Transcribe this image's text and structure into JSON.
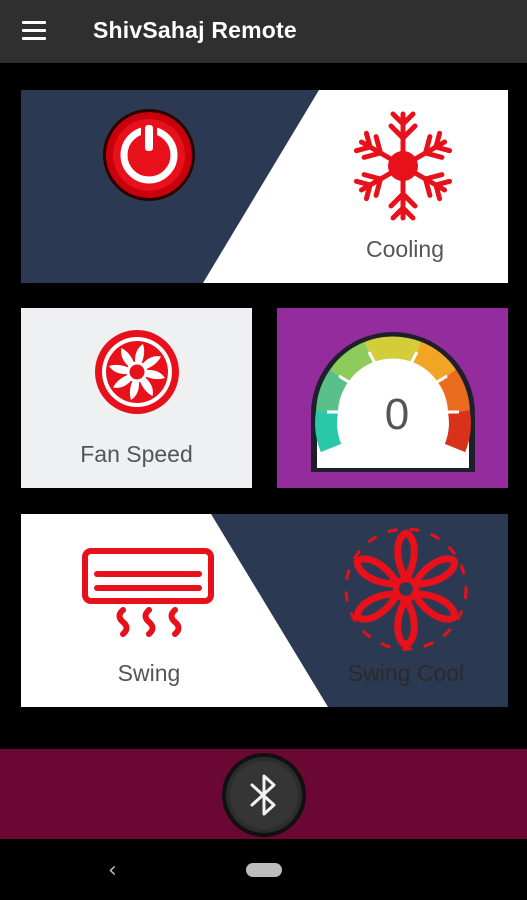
{
  "app": {
    "title": "ShivSahaj Remote"
  },
  "tiles": {
    "power": {
      "icon": "power-icon"
    },
    "cooling": {
      "label": "Cooling",
      "icon": "snowflake-icon"
    },
    "fan_speed": {
      "label": "Fan Speed",
      "icon": "fan-icon"
    },
    "temperature": {
      "value": "0",
      "icon": "gauge-icon"
    },
    "swing": {
      "label": "Swing",
      "icon": "air-conditioner-icon"
    },
    "swing_cool": {
      "label": "Swing Cool",
      "icon": "fan-blades-icon"
    }
  },
  "bluetooth": {
    "icon": "bluetooth-icon"
  },
  "nav": {
    "back_icon": "back-icon",
    "home_icon": "home-pill-icon"
  },
  "colors": {
    "accent_red": "#e8101a",
    "navy": "#2b3a52",
    "purple": "#952c9d",
    "maroon": "#6a0732"
  }
}
